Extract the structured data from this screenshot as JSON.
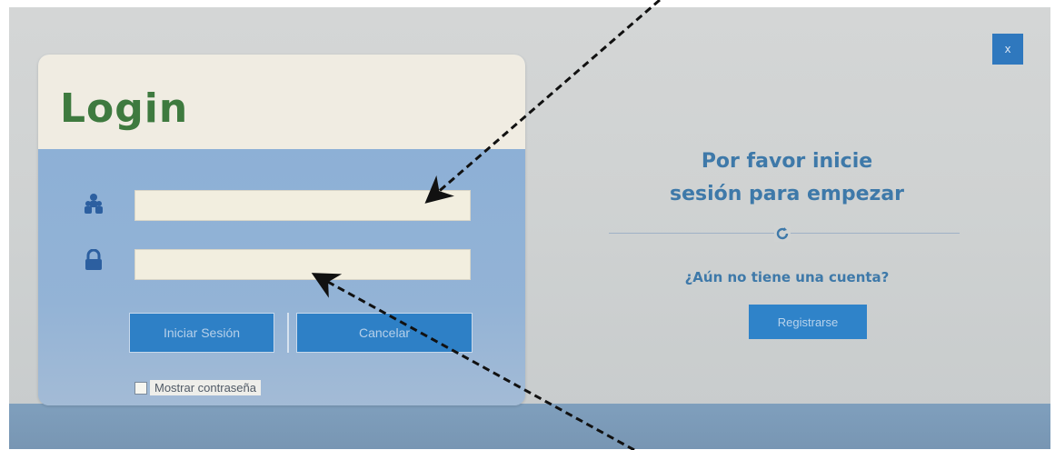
{
  "login": {
    "title": "Login",
    "username_value": "",
    "password_value": "",
    "login_button": "Iniciar Sesión",
    "cancel_button": "Cancelar",
    "show_password_label": "Mostrar contraseña"
  },
  "window": {
    "close_label": "x"
  },
  "welcome": {
    "line1": "Por favor inicie",
    "line2": "sesión para empezar",
    "no_account": "¿Aún no tiene una cuenta?",
    "register_button": "Registrarse"
  },
  "icons": {
    "user": "user-icon",
    "lock": "lock-icon",
    "refresh": "refresh-icon"
  },
  "colors": {
    "accent_blue": "#2e80c6",
    "title_green": "#3e7a3f",
    "heading_blue": "#3e79a9"
  }
}
